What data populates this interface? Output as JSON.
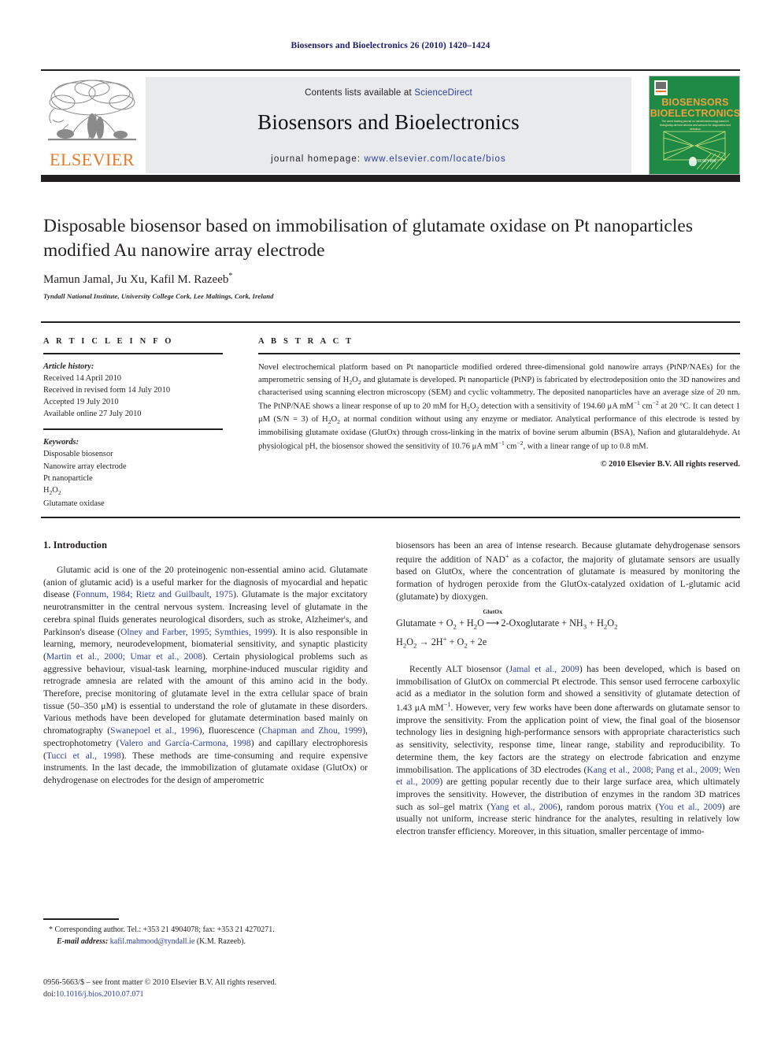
{
  "running_head": "Biosensors and Bioelectronics 26 (2010) 1420–1424",
  "masthead": {
    "publisher_name": "ELSEVIER",
    "contents_prefix": "Contents lists available at",
    "contents_link": "ScienceDirect",
    "journal_name": "Biosensors and Bioelectronics",
    "homepage_prefix": "journal homepage:",
    "homepage_url": "www.elsevier.com/locate/bios",
    "cover": {
      "line1": "BIOSENSORS",
      "line2": "BIOELECTRONICS",
      "subtitle": "The world leading journal on nanobiotechnology-based & biologically-derived devices and sensors for diagnostics and detection"
    }
  },
  "article": {
    "title": "Disposable biosensor based on immobilisation of glutamate oxidase on Pt nanoparticles modified Au nanowire array electrode",
    "authors": "Mamun Jamal, Ju Xu, Kafil M. Razeeb",
    "author_marker": "*",
    "affiliation": "Tyndall National Institute, University College Cork, Lee Maltings, Cork, Ireland"
  },
  "article_info": {
    "heading": "A R T I C L E  I N F O",
    "history_label": "Article history:",
    "history": [
      "Received 14 April 2010",
      "Received in revised form 14 July 2010",
      "Accepted 19 July 2010",
      "Available online 27 July 2010"
    ],
    "keywords_label": "Keywords:",
    "keywords": [
      "Disposable biosensor",
      "Nanowire array electrode",
      "Pt nanoparticle",
      "H2O2",
      "Glutamate oxidase"
    ]
  },
  "abstract": {
    "heading": "A B S T R A C T",
    "text_part1": "Novel electrochemical platform based on Pt nanoparticle modified ordered three-dimensional gold nanowire arrays (PtNP/NAEs) for the amperometric sensing of H",
    "text_part2": "O",
    "text_part3": " and glutamate is developed. Pt nanoparticle (PtNP) is fabricated by electrodeposition onto the 3D nanowires and characterised using scanning electron microscopy (SEM) and cyclic voltammetry. The deposited nanoparticles have an average size of 20 nm. The PtNP/NAE shows a linear response of up to 20 mM for H",
    "text_part4": "O",
    "text_part5": " detection with a sensitivity of 194.60 μA mM",
    "text_part6": " cm",
    "text_part7": " at 20 °C. It can detect 1 μM (S/N = 3) of H",
    "text_part8": "O",
    "text_part9": " at normal condition without using any enzyme or mediator. Analytical performance of this electrode is tested by immobilising glutamate oxidase (GlutOx) through cross-linking in the matrix of bovine serum albumin (BSA), Nafion and glutaraldehyde. At physiological pH, the biosensor showed the sensitivity of 10.76 μA mM",
    "text_part10": " cm",
    "text_part11": ", with a linear range of up to 0.8 mM.",
    "copyright": "© 2010 Elsevier B.V. All rights reserved."
  },
  "body": {
    "section1_heading": "1.  Introduction",
    "left_para1": {
      "s1": "Glutamic acid is one of the 20 proteinogenic non-essential amino acid. Glutamate (anion of glutamic acid) is a useful marker for the diagnosis of myocardial and hepatic disease (",
      "ref1": "Fonnum, 1984; Rietz and Guilbault, 1975",
      "s2": "). Glutamate is the major excitatory neurotransmitter in the central nervous system. Increasing level of glutamate in the cerebra spinal fluids generates neurological disorders, such as stroke, Alzheimer's, and Parkinson's disease (",
      "ref2": "Olney and Farber, 1995; Symthies, 1999",
      "s3": "). It is also responsible in learning, memory, neurodevelopment, biomaterial sensitivity, and synaptic plasticity (",
      "ref3": "Martin et al., 2000; Umar et al., 2008",
      "s4": "). Certain physiological problems such as aggressive behaviour, visual-task learning, morphine-induced muscular rigidity and retrograde amnesia are related with the amount of this amino acid in the body. Therefore, precise monitoring of glutamate level in the extra cellular space of brain tissue (50–350 μM) is essential to understand the role of glutamate in these disorders. Various methods have been developed for glutamate determination based mainly on chromatography (",
      "ref4": "Swanepoel et al., 1996",
      "s5": "), fluorescence (",
      "ref5": "Chapman and Zhou, 1999",
      "s6": "), spectrophotometry (",
      "ref6": "Valero and García-Carmona, 1998",
      "s7": ") and capillary electrophoresis (",
      "ref7": "Tucci et al., 1998",
      "s8": "). These methods are time-consuming and require expensive instruments. In the last decade, the immobilization of glutamate oxidase (GlutOx) or dehydrogenase on electrodes for the design of amperometric"
    },
    "right_para1": {
      "s1": "biosensors has been an area of intense research. Because glutamate dehydrogenase sensors require the addition of NAD",
      "sup1": "+",
      "s2": " as a cofactor, the majority of glutamate sensors are usually based on GlutOx, where the concentration of glutamate is measured by monitoring the formation of hydrogen peroxide from the GlutOx-catalyzed oxidation of L-glutamic acid (glutamate) by dioxygen."
    },
    "equation1": {
      "left": "Glutamate + O",
      "left_sub": "2",
      "mid": " + H",
      "mid_sub": "2",
      "mid2": "O",
      "enzyme_label": "GlutOx",
      "arrow": "⟶",
      "right": "2-Oxoglutarate + NH",
      "right_sub": "3",
      "right2": " + H",
      "right2_sub": "2",
      "right3": "O",
      "right3_sub": "2"
    },
    "equation2": {
      "full": "H2O2 → 2H+ + O2 + 2e"
    },
    "right_para2": {
      "s1": "Recently ALT biosensor (",
      "ref1": "Jamal et al., 2009",
      "s2": ") has been developed, which is based on immobilisation of GlutOx on commercial Pt electrode. This sensor used ferrocene carboxylic acid as a mediator in the solution form and showed a sensitivity of glutamate detection of 1.43 μA mM",
      "sup1": "−1",
      "s3": ". However, very few works have been done afterwards on glutamate sensor to improve the sensitivity. From the application point of view, the final goal of the biosensor technology lies in designing high-performance sensors with appropriate characteristics such as sensitivity, selectivity, response time, linear range, stability and reproducibility. To determine them, the key factors are the strategy on electrode fabrication and enzyme immobilisation. The applications of 3D electrodes (",
      "ref2": "Kang et al., 2008; Pang et al., 2009; Wen et al., 2009",
      "s4": ") are getting popular recently due to their large surface area, which ultimately improves the sensitivity. However, the distribution of enzymes in the random 3D matrices such as sol–gel matrix (",
      "ref3": "Yang et al., 2006",
      "s5": "), random porous matrix (",
      "ref4": "You et al., 2009",
      "s6": ") are usually not uniform, increase steric hindrance for the analytes, resulting in relatively low electron transfer efficiency. Moreover, in this situation, smaller percentage of immo-"
    }
  },
  "footer": {
    "corresponding_marker": "*",
    "corresponding": " Corresponding author. Tel.: +353 21 4904078; fax: +353 21 4270271.",
    "email_label": "E-mail address:",
    "email": "kafil.mahmood@tyndall.ie",
    "email_suffix": " (K.M. Razeeb).",
    "front_matter": "0956-5663/$ – see front matter © 2010 Elsevier B.V. All rights reserved.",
    "doi_label": "doi:",
    "doi": "10.1016/j.bios.2010.07.071"
  }
}
